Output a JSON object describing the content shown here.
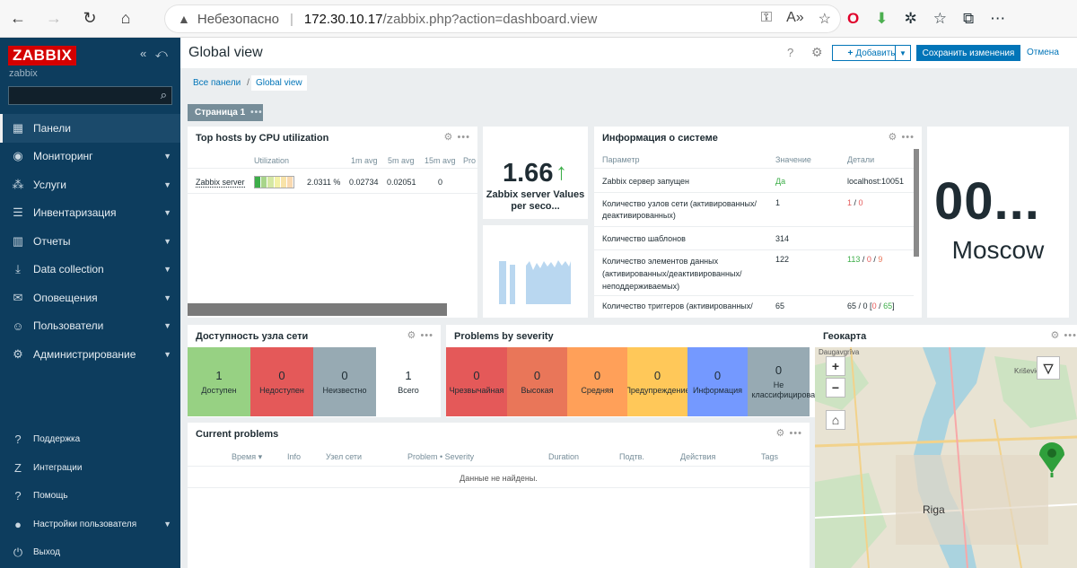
{
  "browser": {
    "security_warning": "Небезопасно",
    "url_host": "172.30.10.17",
    "url_path": "/zabbix.php?action=dashboard.view"
  },
  "sidebar": {
    "logo": "ZABBIX",
    "server_name": "zabbix",
    "search_placeholder": "",
    "items": [
      {
        "label": "Панели",
        "icon": "dashboard-icon",
        "glyph": "▦"
      },
      {
        "label": "Мониторинг",
        "icon": "eye-icon",
        "glyph": "◉"
      },
      {
        "label": "Услуги",
        "icon": "services-icon",
        "glyph": "⁂"
      },
      {
        "label": "Инвентаризация",
        "icon": "list-icon",
        "glyph": "☰"
      },
      {
        "label": "Отчеты",
        "icon": "reports-icon",
        "glyph": "▥"
      },
      {
        "label": "Data collection",
        "icon": "download-icon",
        "glyph": "⤓"
      },
      {
        "label": "Оповещения",
        "icon": "envelope-icon",
        "glyph": "✉"
      },
      {
        "label": "Пользователи",
        "icon": "users-icon",
        "glyph": "☺"
      },
      {
        "label": "Администрирование",
        "icon": "gear-icon",
        "glyph": "⚙"
      }
    ],
    "bottom_items": [
      {
        "label": "Поддержка",
        "icon": "support-icon",
        "glyph": "?"
      },
      {
        "label": "Интеграции",
        "icon": "integrations-icon",
        "glyph": "Z"
      },
      {
        "label": "Помощь",
        "icon": "help-icon",
        "glyph": "?"
      },
      {
        "label": "Настройки пользователя",
        "icon": "user-icon",
        "glyph": "●"
      },
      {
        "label": "Выход",
        "icon": "power-icon",
        "glyph": "⏻"
      }
    ]
  },
  "header": {
    "title": "Global view",
    "add_label": "Добавить",
    "save_label": "Сохранить изменения",
    "cancel_label": "Отмена"
  },
  "breadcrumb": {
    "all": "Все панели",
    "current": "Global view"
  },
  "page_tab": "Страница 1",
  "top_hosts": {
    "title": "Top hosts by CPU utilization",
    "columns": [
      "Utilization",
      "1m avg",
      "5m avg",
      "15m avg",
      "Pro"
    ],
    "row": {
      "host": "Zabbix server",
      "util": "2.0311 %",
      "avg1": "0.02734",
      "avg5": "0.02051",
      "avg15": "0"
    }
  },
  "item_value": {
    "value": "1.66",
    "label": "Zabbix server Values per seco..."
  },
  "system_info": {
    "title": "Информация о системе",
    "columns": [
      "Параметр",
      "Значение",
      "Детали"
    ],
    "rows": [
      {
        "param": "Zabbix сервер запущен",
        "value": "Да",
        "details": "localhost:10051"
      },
      {
        "param": "Количество узлов сети (активированных/ деактивированных)",
        "value": "1",
        "details_a": "1",
        "details_b": "0"
      },
      {
        "param": "Количество шаблонов",
        "value": "314",
        "details": ""
      },
      {
        "param": "Количество элементов данных (активированных/деактивированных/ неподдерживаемых)",
        "value": "122",
        "details_a": "113",
        "details_b": "0",
        "details_c": "9"
      },
      {
        "param": "Количество триггеров (активированных/",
        "value": "65",
        "details_a": "65",
        "details_b": "0",
        "details_c": "0",
        "details_d": "65"
      }
    ]
  },
  "clock": {
    "time": "00...",
    "city": "Moscow"
  },
  "availability": {
    "title": "Доступность узла сети",
    "tiles": [
      {
        "count": "1",
        "label": "Доступен",
        "color": "#97d183"
      },
      {
        "count": "0",
        "label": "Недоступен",
        "color": "#e45959"
      },
      {
        "count": "0",
        "label": "Неизвестно",
        "color": "#97aab3"
      },
      {
        "count": "1",
        "label": "Всего",
        "color": "#ffffff"
      }
    ]
  },
  "severity": {
    "title": "Problems by severity",
    "tiles": [
      {
        "count": "0",
        "label": "Чрезвычайная",
        "color": "#e45959"
      },
      {
        "count": "0",
        "label": "Высокая",
        "color": "#e97659"
      },
      {
        "count": "0",
        "label": "Средняя",
        "color": "#ffa059"
      },
      {
        "count": "0",
        "label": "Предупреждение",
        "color": "#ffc859"
      },
      {
        "count": "0",
        "label": "Информация",
        "color": "#7499ff"
      },
      {
        "count": "0",
        "label": "Не классифицировано",
        "color": "#97aab3"
      }
    ]
  },
  "problems": {
    "title": "Current problems",
    "columns": [
      "Время ▾",
      "Info",
      "Узел сети",
      "Problem • Severity",
      "Duration",
      "Подтв.",
      "Действия",
      "Tags"
    ],
    "empty": "Данные не найдены."
  },
  "geomap": {
    "title": "Геокарта",
    "labels": [
      "Riga",
      "Kriševici",
      "Daugavgrīva"
    ],
    "zoom_in": "+",
    "zoom_out": "−"
  }
}
